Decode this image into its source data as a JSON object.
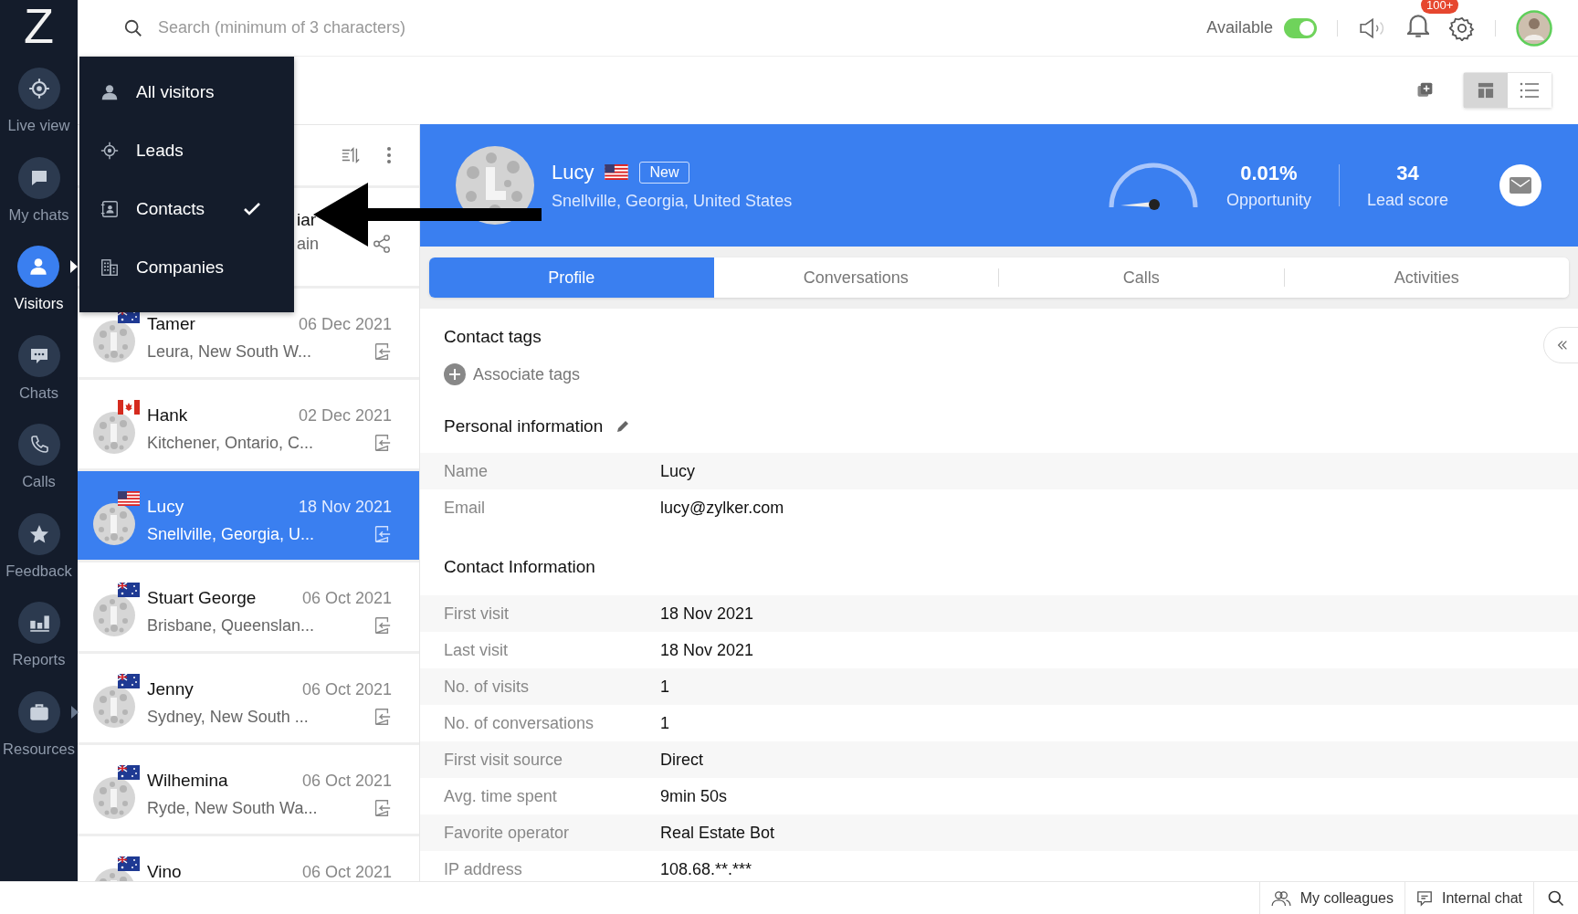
{
  "app": {
    "logo": "Z"
  },
  "sidebar": {
    "items": [
      {
        "label": "Live view",
        "selected": false,
        "has_submenu": false
      },
      {
        "label": "My chats",
        "selected": false,
        "has_submenu": false
      },
      {
        "label": "Visitors",
        "selected": true,
        "has_submenu": true
      },
      {
        "label": "Chats",
        "selected": false,
        "has_submenu": false
      },
      {
        "label": "Calls",
        "selected": false,
        "has_submenu": false
      },
      {
        "label": "Feedback",
        "selected": false,
        "has_submenu": false
      },
      {
        "label": "Reports",
        "selected": false,
        "has_submenu": false
      },
      {
        "label": "Resources",
        "selected": false,
        "has_submenu": true
      }
    ]
  },
  "search": {
    "placeholder": "Search (minimum of 3 characters)"
  },
  "status": {
    "label": "Available",
    "on": true
  },
  "notifications": {
    "badge": "100+"
  },
  "view_toggle": [
    {
      "kind": "grid",
      "selected": true
    },
    {
      "kind": "list",
      "selected": false
    }
  ],
  "visitor_menu": {
    "items": [
      {
        "label": "All visitors",
        "kind": "person",
        "selected": false
      },
      {
        "label": "Leads",
        "kind": "target",
        "selected": false
      },
      {
        "label": "Contacts",
        "kind": "contact",
        "selected": true
      },
      {
        "label": "Companies",
        "kind": "building",
        "selected": false
      }
    ]
  },
  "visitor_list": {
    "items": [
      {
        "kind": "shared",
        "name": "iar",
        "location": "ain",
        "selected": false
      },
      {
        "kind": "au",
        "name": "Tamer",
        "date": "06 Dec 2021",
        "location": "Leura, New South W...",
        "selected": false
      },
      {
        "kind": "ca",
        "name": "Hank",
        "date": "02 Dec 2021",
        "location": "Kitchener, Ontario, C...",
        "selected": false
      },
      {
        "kind": "us",
        "name": "Lucy",
        "date": "18 Nov 2021",
        "location": "Snellville, Georgia, U...",
        "selected": true
      },
      {
        "kind": "au",
        "name": "Stuart George",
        "date": "06 Oct 2021",
        "location": "Brisbane, Queenslan...",
        "selected": false
      },
      {
        "kind": "au",
        "name": "Jenny",
        "date": "06 Oct 2021",
        "location": "Sydney, New South ...",
        "selected": false
      },
      {
        "kind": "au",
        "name": "Wilhemina",
        "date": "06 Oct 2021",
        "location": "Ryde, New South Wa...",
        "selected": false
      },
      {
        "kind": "au",
        "name": "Vino",
        "date": "06 Oct 2021",
        "selected": false
      }
    ]
  },
  "profile": {
    "kind": "us",
    "name": "Lucy",
    "badge": "New",
    "location": "Snellville, Georgia, United States",
    "opportunity": "0.01%",
    "opportunity_label": "Opportunity",
    "lead_score": "34",
    "lead_score_label": "Lead score"
  },
  "tabs": [
    {
      "label": "Profile",
      "selected": true
    },
    {
      "label": "Conversations",
      "selected": false
    },
    {
      "label": "Calls",
      "selected": false
    },
    {
      "label": "Activities",
      "selected": false
    }
  ],
  "contact_tags": {
    "title": "Contact tags",
    "action": "Associate tags"
  },
  "personal_info": {
    "title": "Personal information",
    "rows": [
      {
        "label": "Name",
        "value": "Lucy"
      },
      {
        "label": "Email",
        "value": "lucy@zylker.com"
      }
    ]
  },
  "contact_info": {
    "title": "Contact Information",
    "rows": [
      {
        "label": "First visit",
        "value": "18 Nov 2021"
      },
      {
        "label": "Last visit",
        "value": "18 Nov 2021"
      },
      {
        "label": "No. of visits",
        "value": "1"
      },
      {
        "label": "No. of conversations",
        "value": "1"
      },
      {
        "label": "First visit source",
        "value": "Direct"
      },
      {
        "label": "Avg. time spent",
        "value": "9min 50s"
      },
      {
        "label": "Favorite operator",
        "value": "Real Estate Bot"
      },
      {
        "label": "IP address",
        "value": "108.68.**.***"
      }
    ]
  },
  "footer": {
    "items": [
      {
        "label": "My colleagues",
        "kind": "colleagues"
      },
      {
        "label": "Internal chat",
        "kind": "chat"
      }
    ]
  }
}
